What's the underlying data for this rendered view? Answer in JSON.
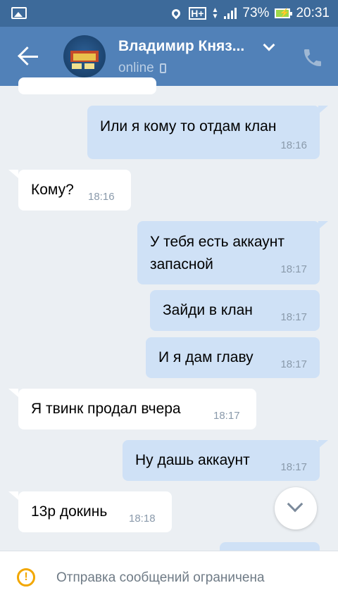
{
  "status_bar": {
    "battery": "73%",
    "time": "20:31",
    "network": "H+"
  },
  "header": {
    "name": "Владимир Княз...",
    "status": "online"
  },
  "messages": [
    {
      "dir": "out",
      "text": "Или я кому то отдам клан",
      "time": "18:16"
    },
    {
      "dir": "in",
      "text": "Кому?",
      "time": "18:16"
    },
    {
      "dir": "out",
      "line1": "У тебя есть аккаунт",
      "line2": "запасной",
      "time": "18:17"
    },
    {
      "dir": "out",
      "text": "Зайди в клан",
      "time": "18:17"
    },
    {
      "dir": "out",
      "text": "И я дам главу",
      "time": "18:17"
    },
    {
      "dir": "in",
      "text": "Я твинк продал вчера",
      "time": "18:17"
    },
    {
      "dir": "out",
      "text": "Ну дашь аккаунт",
      "time": "18:17"
    },
    {
      "dir": "in",
      "text": "13р докинь",
      "time": "18:18"
    }
  ],
  "footer": {
    "notice": "Отправка сообщений ограничена"
  }
}
